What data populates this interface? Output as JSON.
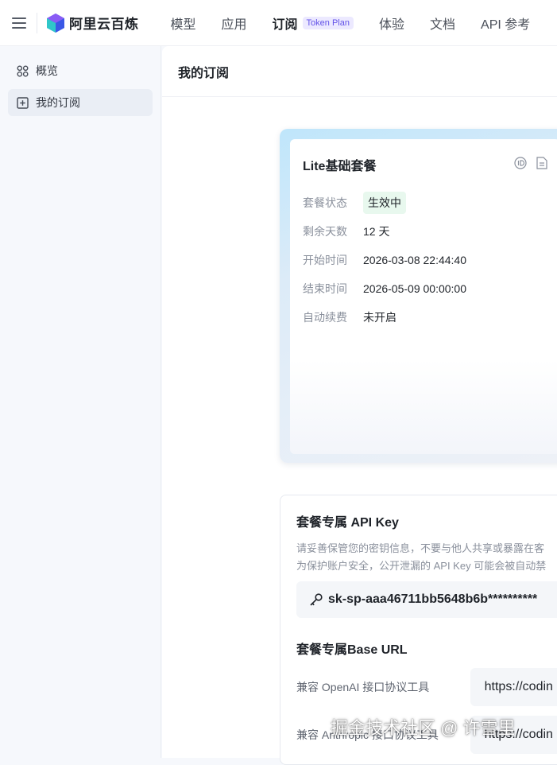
{
  "app": {
    "name": "阿里云百炼"
  },
  "nav": {
    "items": [
      {
        "label": "模型"
      },
      {
        "label": "应用"
      },
      {
        "label": "订阅",
        "tag": "Token Plan"
      },
      {
        "label": "体验"
      },
      {
        "label": "文档"
      },
      {
        "label": "API 参考"
      }
    ]
  },
  "sidebar": {
    "items": [
      {
        "label": "概览",
        "icon": "grid-icon"
      },
      {
        "label": "我的订阅",
        "icon": "add-box-icon"
      }
    ]
  },
  "page": {
    "title": "我的订阅"
  },
  "plan": {
    "title": "Lite基础套餐",
    "rows": [
      {
        "key": "套餐状态",
        "value": "生效中"
      },
      {
        "key": "剩余天数",
        "value": "12 天"
      },
      {
        "key": "开始时间",
        "value": "2026-03-08 22:44:40"
      },
      {
        "key": "结束时间",
        "value": "2026-05-09 00:00:00"
      },
      {
        "key": "自动续费",
        "value": "未开启"
      }
    ],
    "status_color": "#1fa35a"
  },
  "api_key": {
    "title": "套餐专属 API Key",
    "hint1": "请妥善保管您的密钥信息，不要与他人共享或暴露在客",
    "hint2": "为保护账户安全，公开泄漏的 API Key 可能会被自动禁",
    "value": "sk-sp-aaa46711bb5648b6b**********"
  },
  "base_url": {
    "title": "套餐专属Base URL",
    "rows": [
      {
        "label": "兼容 OpenAI 接口协议工具",
        "value": "https://codin"
      },
      {
        "label": "兼容 Anthropic 接口协议工具",
        "value": "https://codin"
      }
    ]
  },
  "watermark": "掘金技术社区 @ 许雪里",
  "colors": {
    "accent": "#6353e8",
    "success": "#1fa35a"
  }
}
